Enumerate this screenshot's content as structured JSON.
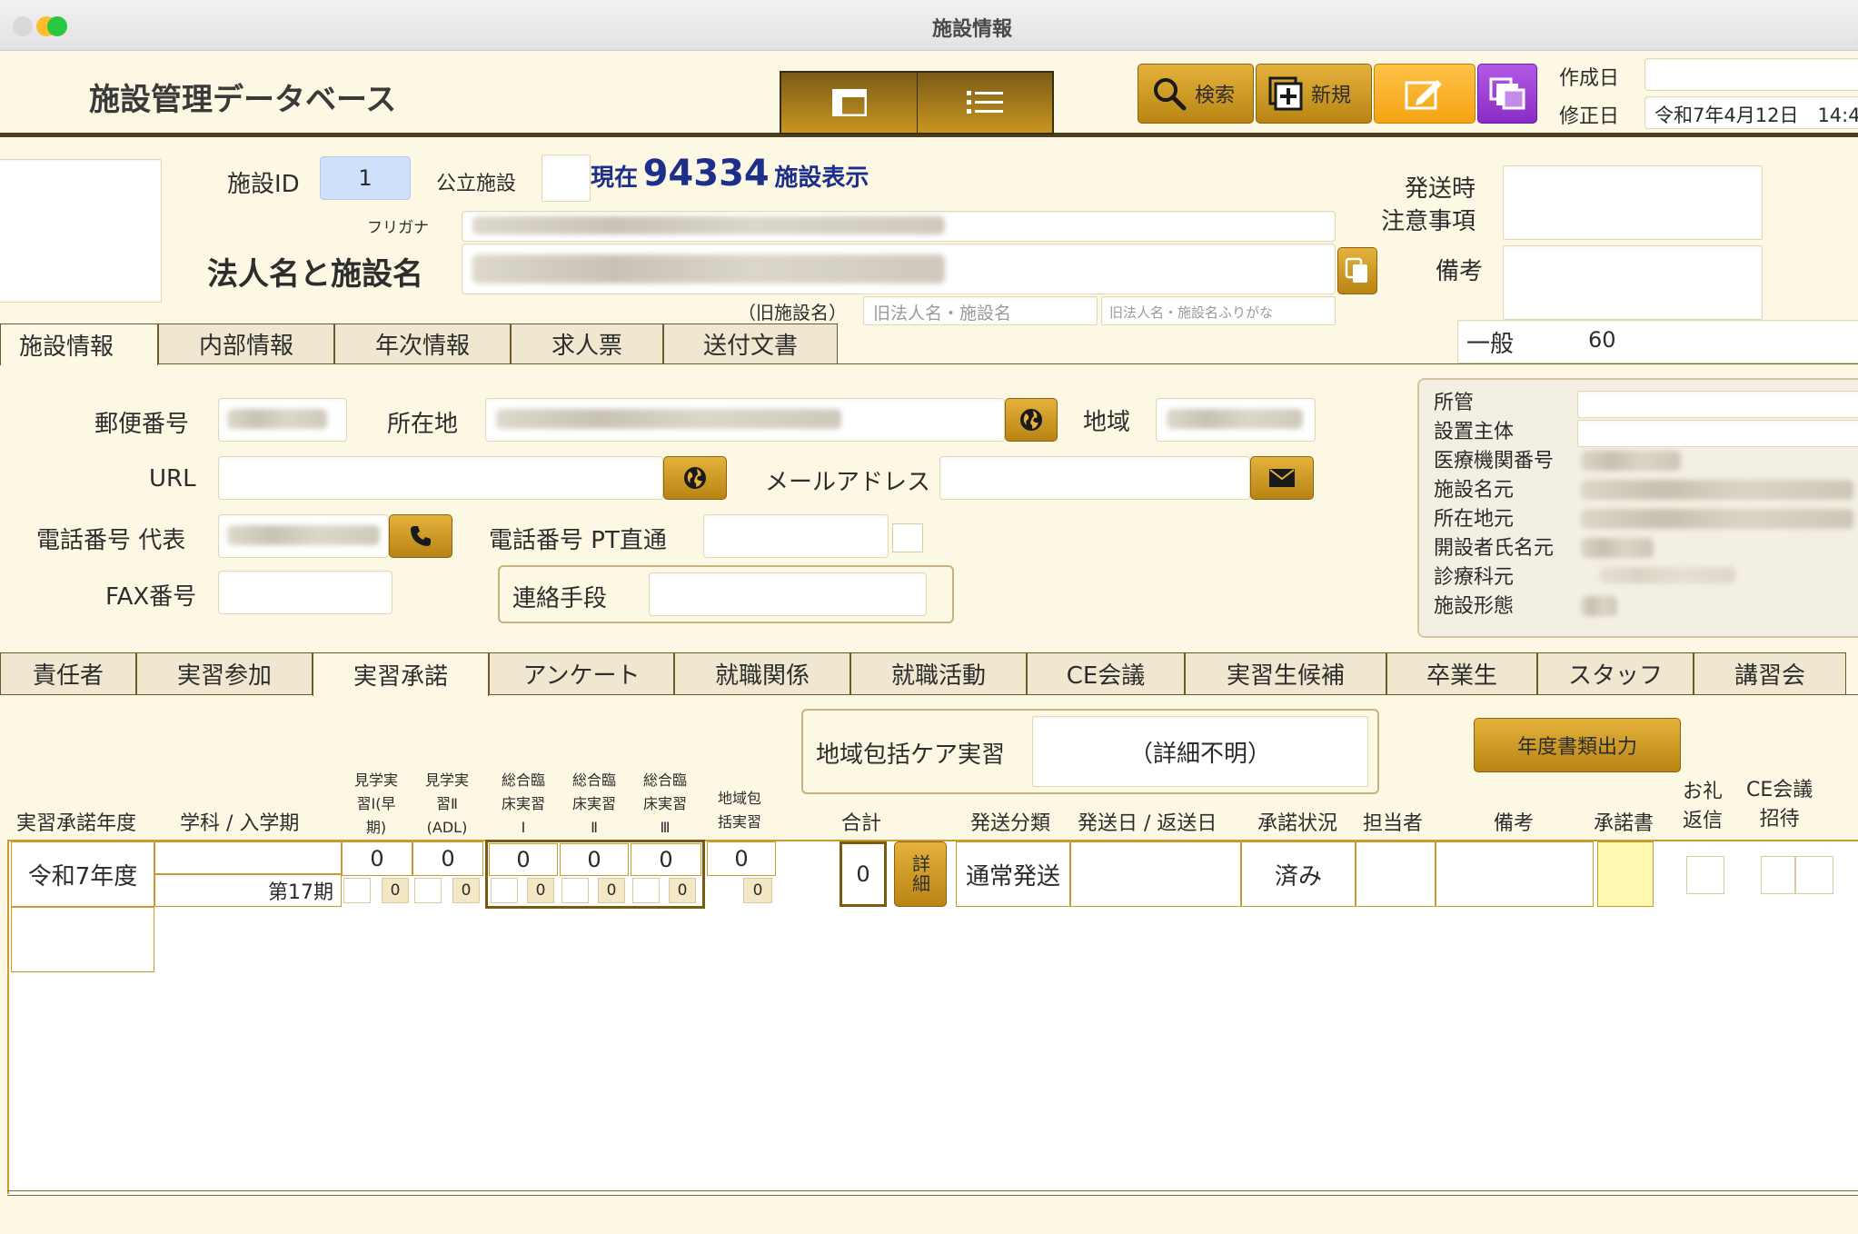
{
  "window": {
    "title": "施設情報"
  },
  "header": {
    "app_title": "施設管理データベース",
    "buttons": {
      "search": "検索",
      "new": "新規"
    },
    "created_label": "作成日",
    "created_value": "",
    "modified_label": "修正日",
    "modified_value": "令和7年4月12日　14:4"
  },
  "facility": {
    "id_label": "施設ID",
    "id_value": "1",
    "public_label": "公立施設",
    "public_value": "",
    "current_prefix": "現在",
    "current_count": "94334",
    "current_suffix": "施設表示",
    "furigana_label": "フリガナ",
    "name_label": "法人名と施設名",
    "old_name_label": "（旧施設名）",
    "old_name_placeholder": "旧法人名・施設名",
    "old_kana_placeholder": "旧法人名・施設名ふりがな",
    "send_note_label_1": "発送時",
    "send_note_label_2": "注意事項",
    "remarks_label": "備考",
    "category_label": "一般",
    "category_value": "60"
  },
  "tabs_top": [
    "施設情報",
    "内部情報",
    "年次情報",
    "求人票",
    "送付文書"
  ],
  "contact": {
    "postal_label": "郵便番号",
    "address_label": "所在地",
    "region_label": "地域",
    "url_label": "URL",
    "url_value": "",
    "email_label": "メールアドレス",
    "email_value": "",
    "phone_label": "電話番号 代表",
    "phone_pt_label": "電話番号 PT直通",
    "phone_pt_value": "",
    "fax_label": "FAX番号",
    "fax_value": "",
    "contact_method_label": "連絡手段",
    "contact_method_value": ""
  },
  "side_panel": {
    "labels": [
      "所管",
      "設置主体",
      "医療機関番号",
      "施設名元",
      "所在地元",
      "開設者氏名元",
      "診療科元",
      "施設形態"
    ]
  },
  "tabs_bottom": [
    "責任者",
    "実習参加",
    "実習承諾",
    "アンケート",
    "就職関係",
    "就職活動",
    "CE会議",
    "実習生候補",
    "卒業生",
    "スタッフ",
    "講習会"
  ],
  "practicum": {
    "regional_label": "地域包括ケア実習",
    "regional_value": "（詳細不明）",
    "report_button": "年度書類出力",
    "headers": {
      "year": "実習承諾年度",
      "dept": "学科 / 入学期",
      "obs1": [
        "見学実",
        "習Ⅰ(早",
        "期)"
      ],
      "obs2": [
        "見学実",
        "習Ⅱ",
        "(ADL)"
      ],
      "gen1": [
        "総合臨",
        "床実習",
        "Ⅰ"
      ],
      "gen2": [
        "総合臨",
        "床実習",
        "Ⅱ"
      ],
      "gen3": [
        "総合臨",
        "床実習",
        "Ⅲ"
      ],
      "regional": [
        "地域包",
        "括実習"
      ],
      "total": "合計",
      "send_type": "発送分類",
      "send_date": "発送日 / 返送日",
      "status": "承諾状況",
      "person": "担当者",
      "remarks": "備考",
      "consent": "承諾書",
      "thanks": [
        "お礼",
        "返信"
      ],
      "ce": [
        "CE会議",
        "招待"
      ]
    },
    "row": {
      "year": "令和7年度",
      "dept": "",
      "term": "第17期",
      "obs1": "0",
      "obs1_sub": "0",
      "obs2": "0",
      "obs2_sub": "0",
      "gen1": "0",
      "gen1_sub": "0",
      "gen2": "0",
      "gen2_sub": "0",
      "gen3": "0",
      "gen3_sub": "0",
      "regional": "0",
      "regional_sub": "0",
      "total": "0",
      "detail_button": "詳細",
      "send_type": "通常発送",
      "send_date": "",
      "status": "済み",
      "person": "",
      "remarks": ""
    }
  }
}
